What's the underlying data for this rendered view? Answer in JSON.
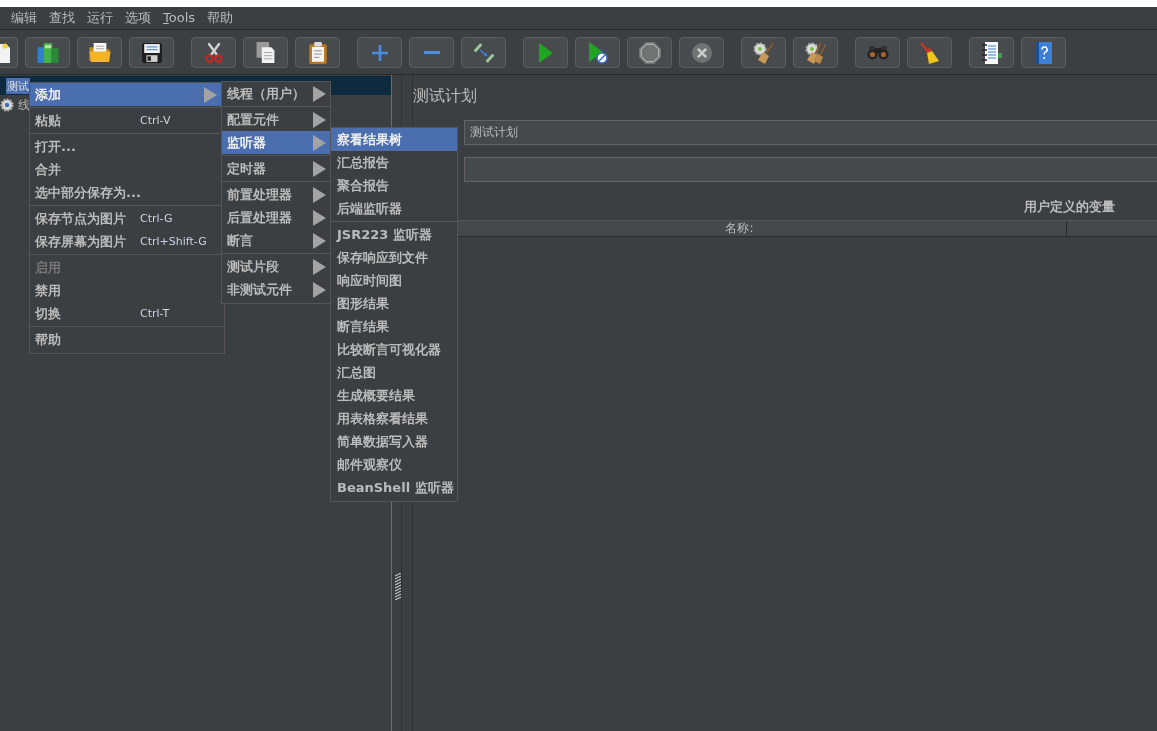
{
  "menu_bar": [
    {
      "label": "编辑",
      "mnemonic": false
    },
    {
      "label": "查找",
      "mnemonic": false
    },
    {
      "label": "运行",
      "mnemonic": false
    },
    {
      "label": "选项",
      "mnemonic": false
    },
    {
      "label": "Tools",
      "mnemonic": true
    },
    {
      "label": "帮助",
      "mnemonic": false
    }
  ],
  "toolbar": {
    "groups": [
      [
        {
          "kind": "new",
          "disabled": false
        },
        {
          "kind": "templates",
          "disabled": false
        },
        {
          "kind": "open",
          "disabled": false
        },
        {
          "kind": "save",
          "disabled": false
        }
      ],
      [
        {
          "kind": "cut",
          "disabled": false
        },
        {
          "kind": "copy",
          "disabled": false
        },
        {
          "kind": "paste",
          "disabled": false
        }
      ],
      [
        {
          "kind": "expand",
          "disabled": false
        },
        {
          "kind": "collapse",
          "disabled": false
        },
        {
          "kind": "toggle",
          "disabled": false
        }
      ],
      [
        {
          "kind": "start",
          "disabled": false
        },
        {
          "kind": "start_no_pauses",
          "disabled": false
        },
        {
          "kind": "stop",
          "disabled": true
        },
        {
          "kind": "shutdown",
          "disabled": true
        }
      ],
      [
        {
          "kind": "clear",
          "disabled": false
        },
        {
          "kind": "clear_all",
          "disabled": false
        }
      ],
      [
        {
          "kind": "search",
          "disabled": false
        },
        {
          "kind": "reset_search",
          "disabled": false
        }
      ],
      [
        {
          "kind": "function_helper",
          "disabled": false
        },
        {
          "kind": "help",
          "disabled": false
        }
      ]
    ]
  },
  "tree": [
    {
      "label": "测试",
      "selected": true,
      "children": [
        {
          "label": "线",
          "selected": false
        }
      ]
    }
  ],
  "editor": {
    "title": "测试计划",
    "fields": [
      {
        "kind": "text",
        "value": "测试计划"
      },
      {
        "kind": "text"
      }
    ],
    "variables": {
      "title": "用户定义的变量",
      "columns": [
        "名称:"
      ]
    }
  },
  "context_menu": {
    "groups": [
      [
        {
          "label": "添加",
          "submenu": true,
          "selected": true,
          "disabled": false
        }
      ],
      [
        {
          "label": "粘贴",
          "shortcut": "Ctrl-V",
          "submenu": false,
          "selected": false,
          "disabled": false
        }
      ],
      [
        {
          "label": "打开...",
          "submenu": false,
          "selected": false,
          "disabled": false
        },
        {
          "label": "合并",
          "submenu": false,
          "selected": false,
          "disabled": false
        },
        {
          "label": "选中部分保存为...",
          "submenu": false,
          "selected": false,
          "disabled": false
        }
      ],
      [
        {
          "label": "保存节点为图片",
          "shortcut": "Ctrl-G",
          "submenu": false,
          "selected": false,
          "disabled": false
        },
        {
          "label": "保存屏幕为图片",
          "shortcut": "Ctrl+Shift-G",
          "submenu": false,
          "selected": false,
          "disabled": false
        }
      ],
      [
        {
          "label": "启用",
          "submenu": false,
          "selected": false,
          "disabled": true
        },
        {
          "label": "禁用",
          "submenu": false,
          "selected": false,
          "disabled": false
        },
        {
          "label": "切换",
          "shortcut": "Ctrl-T",
          "submenu": false,
          "selected": false,
          "disabled": false
        }
      ],
      [
        {
          "label": "帮助",
          "submenu": false,
          "selected": false,
          "disabled": false
        }
      ]
    ]
  },
  "add_submenu": {
    "groups": [
      [
        {
          "label": "线程（用户）",
          "submenu": true,
          "selected": false
        }
      ],
      [
        {
          "label": "配置元件",
          "submenu": true,
          "selected": false
        },
        {
          "label": "监听器",
          "submenu": true,
          "selected": true
        }
      ],
      [
        {
          "label": "定时器",
          "submenu": true,
          "selected": false
        }
      ],
      [
        {
          "label": "前置处理器",
          "submenu": true,
          "selected": false
        },
        {
          "label": "后置处理器",
          "submenu": true,
          "selected": false
        },
        {
          "label": "断言",
          "submenu": true,
          "selected": false
        }
      ],
      [
        {
          "label": "测试片段",
          "submenu": true,
          "selected": false
        },
        {
          "label": "非测试元件",
          "submenu": true,
          "selected": false
        }
      ]
    ]
  },
  "listener_submenu": {
    "groups": [
      [
        {
          "label": "察看结果树",
          "selected": true
        },
        {
          "label": "汇总报告",
          "selected": false
        },
        {
          "label": "聚合报告",
          "selected": false
        },
        {
          "label": "后端监听器",
          "selected": false
        }
      ],
      [
        {
          "label": "JSR223 监听器",
          "selected": false
        },
        {
          "label": "保存响应到文件",
          "selected": false
        },
        {
          "label": "响应时间图",
          "selected": false
        },
        {
          "label": "图形结果",
          "selected": false
        },
        {
          "label": "断言结果",
          "selected": false
        },
        {
          "label": "比较断言可视化器",
          "selected": false
        },
        {
          "label": "汇总图",
          "selected": false
        },
        {
          "label": "生成概要结果",
          "selected": false
        },
        {
          "label": "用表格察看结果",
          "selected": false
        },
        {
          "label": "简单数据写入器",
          "selected": false
        },
        {
          "label": "邮件观察仪",
          "selected": false
        },
        {
          "label": "BeanShell 监听器",
          "selected": false
        }
      ]
    ]
  }
}
